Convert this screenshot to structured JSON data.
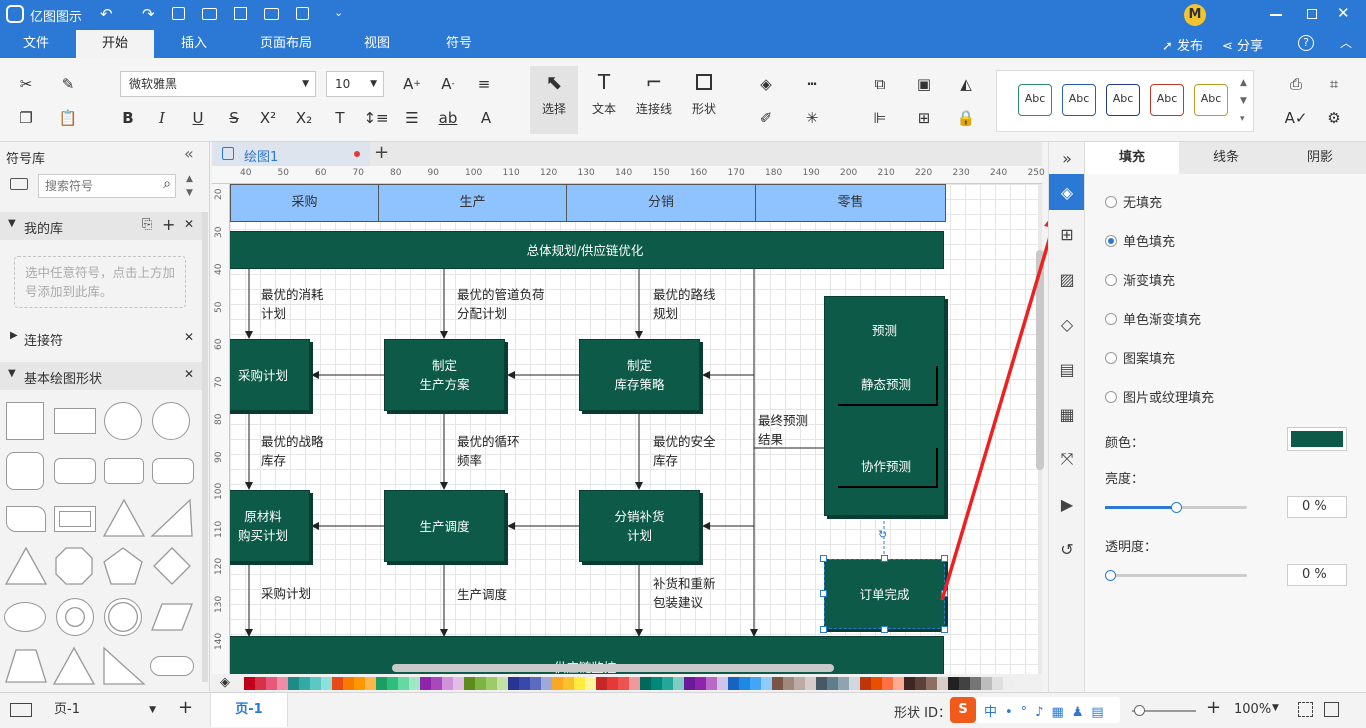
{
  "app": {
    "title": "亿图图示"
  },
  "menu_tabs": [
    "文件",
    "开始",
    "插入",
    "页面布局",
    "视图",
    "符号"
  ],
  "header_right": {
    "publish": "发布",
    "share": "分享"
  },
  "ribbon": {
    "font_name": "微软雅黑",
    "font_size": "10",
    "tools": {
      "select": "选择",
      "text": "文本",
      "connector": "连接线",
      "shape": "形状"
    },
    "style_samples": [
      "Abc",
      "Abc",
      "Abc",
      "Abc",
      "Abc"
    ],
    "style_colors": [
      "#2e8b6f",
      "#2b5fb3",
      "#233b8a",
      "#c0392b",
      "#c49a23"
    ]
  },
  "sidebar": {
    "title": "符号库",
    "search_placeholder": "搜索符号",
    "my_library": "我的库",
    "my_library_hint": "选中任意符号，点击上方加号添加到此库。",
    "connectors": "连接符",
    "basic_shapes": "基本绘图形状"
  },
  "document": {
    "tab_name": "绘图1"
  },
  "rulers": {
    "h": [
      "40",
      "50",
      "60",
      "70",
      "80",
      "90",
      "100",
      "110",
      "120",
      "130",
      "140",
      "150",
      "160",
      "170",
      "180",
      "190",
      "200",
      "210",
      "220",
      "230",
      "240",
      "250"
    ],
    "v": [
      "20",
      "30",
      "40",
      "50",
      "60",
      "70",
      "80",
      "90",
      "100",
      "110",
      "120",
      "130",
      "140"
    ]
  },
  "diagram": {
    "headers": [
      "采购",
      "生产",
      "分销",
      "零售"
    ],
    "top_bar": "总体规划/供应链优化",
    "bottom_bar": "供应链监控",
    "boxes": {
      "purchase_plan": "采购计划",
      "production_plan": "制定\n生产方案",
      "inventory_strategy": "制定\n库存策略",
      "material_plan": "原材料\n购买计划",
      "production_schedule": "生产调度",
      "distribution_plan": "分销补货\n计划",
      "forecast": "预测",
      "static_forecast": "静态预测",
      "collab_forecast": "协作预测",
      "order_complete": "订单完成"
    },
    "labels": {
      "l1": "最优的消耗\n计划",
      "l2": "最优的管道负荷\n分配计划",
      "l3": "最优的路线\n规划",
      "l4": "最优的战略\n库存",
      "l5": "最优的循环\n频率",
      "l6": "最优的安全\n库存",
      "l7": "最终预测\n结果",
      "l8": "采购计划",
      "l9": "生产调度",
      "l10": "补货和重新\n包装建议"
    }
  },
  "right_panel": {
    "tabs": [
      "填充",
      "线条",
      "阴影"
    ],
    "fill_options": [
      "无填充",
      "单色填充",
      "渐变填充",
      "单色渐变填充",
      "图案填充",
      "图片或纹理填充"
    ],
    "selected_fill": "单色填充",
    "color_label": "颜色：",
    "color_value": "#0d5a48",
    "brightness_label": "亮度：",
    "brightness_value": "0 %",
    "transparency_label": "透明度：",
    "transparency_value": "0 %"
  },
  "statusbar": {
    "page_select": "页-1",
    "page_tab": "页-1",
    "shape_id": "形状 ID：",
    "zoom": "100%"
  },
  "palette": [
    "#c0001a",
    "#d9304a",
    "#e8577a",
    "#ef8da7",
    "#1d8b88",
    "#33aaa6",
    "#5cc8c4",
    "#8de0dc",
    "#e64a19",
    "#f57c00",
    "#ff9800",
    "#ffb74d",
    "#1a9e63",
    "#2fbf7c",
    "#66d9a3",
    "#9ee8c4",
    "#8e24aa",
    "#ab47bc",
    "#ce93d8",
    "#e1bee7",
    "#5d8c1c",
    "#7cb342",
    "#9ccc65",
    "#c5e1a5",
    "#283593",
    "#3949ab",
    "#5c6bc0",
    "#9fa8da",
    "#f9a825",
    "#fbc02d",
    "#ffeb3b",
    "#fff59d",
    "#c62828",
    "#e53935",
    "#ef5350",
    "#ef9a9a",
    "#00695c",
    "#00897b",
    "#26a69a",
    "#80cbc4",
    "#6a1b9a",
    "#8e24aa",
    "#ba68c8",
    "#d1c4e9",
    "#1565c0",
    "#1e88e5",
    "#42a5f5",
    "#90caf9",
    "#795548",
    "#a1887f",
    "#bcaaa4",
    "#d7ccc8",
    "#455a64",
    "#607d8b",
    "#90a4ae",
    "#cfd8dc",
    "#bf360c",
    "#e65100",
    "#ff7043",
    "#ffab91",
    "#3e2723",
    "#5d4037",
    "#8d6e63",
    "#d7ccc8",
    "#212121",
    "#424242",
    "#757575",
    "#bdbdbd",
    "#e0e0e0",
    "#eeeeee"
  ]
}
